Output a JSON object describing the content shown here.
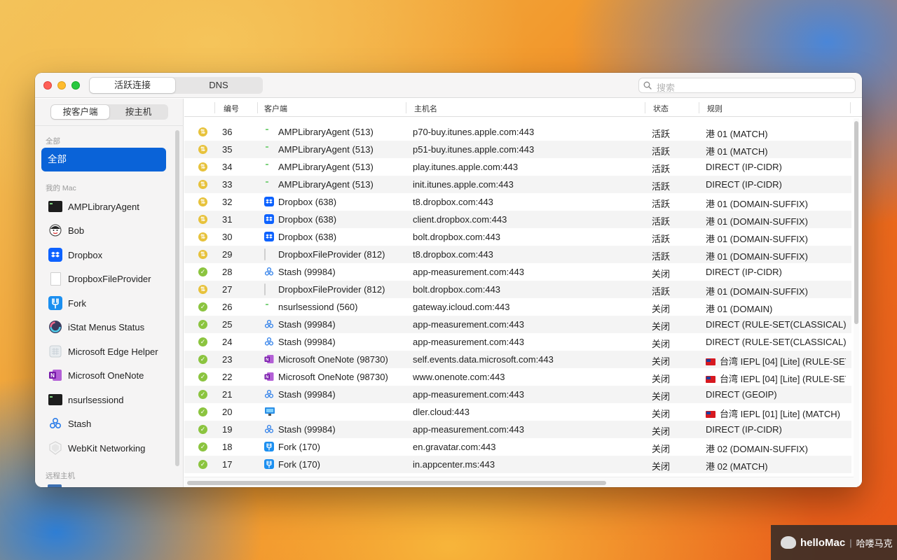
{
  "toolbar": {
    "tabs": [
      {
        "label": "活跃连接",
        "active": true
      },
      {
        "label": "DNS",
        "active": false
      }
    ],
    "search_placeholder": "搜索"
  },
  "sidebar": {
    "segments": [
      {
        "label": "按客户端",
        "active": true
      },
      {
        "label": "按主机",
        "active": false
      }
    ],
    "section_all": "全部",
    "selected": "全部",
    "section_mac": "我的 Mac",
    "items": [
      {
        "label": "AMPLibraryAgent",
        "icon": "terminal-icon"
      },
      {
        "label": "Bob",
        "icon": "bob-icon"
      },
      {
        "label": "Dropbox",
        "icon": "dropbox-icon"
      },
      {
        "label": "DropboxFileProvider",
        "icon": "document-icon"
      },
      {
        "label": "Fork",
        "icon": "fork-icon"
      },
      {
        "label": "iStat Menus Status",
        "icon": "istat-icon"
      },
      {
        "label": "Microsoft Edge Helper",
        "icon": "generic-app-icon"
      },
      {
        "label": "Microsoft OneNote",
        "icon": "onenote-icon"
      },
      {
        "label": "nsurlsessiond",
        "icon": "terminal-icon"
      },
      {
        "label": "Stash",
        "icon": "stash-icon"
      },
      {
        "label": "WebKit Networking",
        "icon": "webkit-icon"
      }
    ],
    "section_remote": "远程主机"
  },
  "table": {
    "headers": {
      "num": "编号",
      "client": "客户端",
      "host": "主机名",
      "state": "状态",
      "rule": "规则"
    },
    "rows": [
      {
        "status": "active",
        "num": "36",
        "client_icon": "terminal-icon",
        "client": "AMPLibraryAgent (513)",
        "host": "p70-buy.itunes.apple.com:443",
        "state": "活跃",
        "rule": "港 01 (MATCH)",
        "flag": false
      },
      {
        "status": "active",
        "num": "35",
        "client_icon": "terminal-icon",
        "client": "AMPLibraryAgent (513)",
        "host": "p51-buy.itunes.apple.com:443",
        "state": "活跃",
        "rule": "港 01 (MATCH)",
        "flag": false
      },
      {
        "status": "active",
        "num": "34",
        "client_icon": "terminal-icon",
        "client": "AMPLibraryAgent (513)",
        "host": "play.itunes.apple.com:443",
        "state": "活跃",
        "rule": "DIRECT (IP-CIDR)",
        "flag": false
      },
      {
        "status": "active",
        "num": "33",
        "client_icon": "terminal-icon",
        "client": "AMPLibraryAgent (513)",
        "host": "init.itunes.apple.com:443",
        "state": "活跃",
        "rule": "DIRECT (IP-CIDR)",
        "flag": false
      },
      {
        "status": "active",
        "num": "32",
        "client_icon": "dropbox-icon",
        "client": "Dropbox (638)",
        "host": "t8.dropbox.com:443",
        "state": "活跃",
        "rule": "港 01 (DOMAIN-SUFFIX)",
        "flag": false
      },
      {
        "status": "active",
        "num": "31",
        "client_icon": "dropbox-icon",
        "client": "Dropbox (638)",
        "host": "client.dropbox.com:443",
        "state": "活跃",
        "rule": "港 01 (DOMAIN-SUFFIX)",
        "flag": false
      },
      {
        "status": "active",
        "num": "30",
        "client_icon": "dropbox-icon",
        "client": "Dropbox (638)",
        "host": "bolt.dropbox.com:443",
        "state": "活跃",
        "rule": "港 01 (DOMAIN-SUFFIX)",
        "flag": false
      },
      {
        "status": "active",
        "num": "29",
        "client_icon": "document-icon",
        "client": "DropboxFileProvider (812)",
        "host": "t8.dropbox.com:443",
        "state": "活跃",
        "rule": "港 01 (DOMAIN-SUFFIX)",
        "flag": false
      },
      {
        "status": "closed",
        "num": "28",
        "client_icon": "stash-icon",
        "client": "Stash (99984)",
        "host": "app-measurement.com:443",
        "state": "关闭",
        "rule": "DIRECT (IP-CIDR)",
        "flag": false
      },
      {
        "status": "active",
        "num": "27",
        "client_icon": "document-icon",
        "client": "DropboxFileProvider (812)",
        "host": "bolt.dropbox.com:443",
        "state": "活跃",
        "rule": "港 01 (DOMAIN-SUFFIX)",
        "flag": false
      },
      {
        "status": "closed",
        "num": "26",
        "client_icon": "terminal-icon",
        "client": "nsurlsessiond (560)",
        "host": "gateway.icloud.com:443",
        "state": "关闭",
        "rule": "港 01 (DOMAIN)",
        "flag": false
      },
      {
        "status": "closed",
        "num": "25",
        "client_icon": "stash-icon",
        "client": "Stash (99984)",
        "host": "app-measurement.com:443",
        "state": "关闭",
        "rule": "DIRECT (RULE-SET(CLASSICAL))",
        "flag": false
      },
      {
        "status": "closed",
        "num": "24",
        "client_icon": "stash-icon",
        "client": "Stash (99984)",
        "host": "app-measurement.com:443",
        "state": "关闭",
        "rule": "DIRECT (RULE-SET(CLASSICAL))",
        "flag": false
      },
      {
        "status": "closed",
        "num": "23",
        "client_icon": "onenote-icon",
        "client": "Microsoft OneNote (98730)",
        "host": "self.events.data.microsoft.com:443",
        "state": "关闭",
        "rule": "台湾 IEPL [04] [Lite] (RULE-SET",
        "flag": true
      },
      {
        "status": "closed",
        "num": "22",
        "client_icon": "onenote-icon",
        "client": "Microsoft OneNote (98730)",
        "host": "www.onenote.com:443",
        "state": "关闭",
        "rule": "台湾 IEPL [04] [Lite] (RULE-SET",
        "flag": true
      },
      {
        "status": "closed",
        "num": "21",
        "client_icon": "stash-icon",
        "client": "Stash (99984)",
        "host": "app-measurement.com:443",
        "state": "关闭",
        "rule": "DIRECT (GEOIP)",
        "flag": false
      },
      {
        "status": "closed",
        "num": "20",
        "client_icon": "monitor-icon",
        "client": "",
        "host": "dler.cloud:443",
        "state": "关闭",
        "rule": "台湾 IEPL [01] [Lite] (MATCH)",
        "flag": true
      },
      {
        "status": "closed",
        "num": "19",
        "client_icon": "stash-icon",
        "client": "Stash (99984)",
        "host": "app-measurement.com:443",
        "state": "关闭",
        "rule": "DIRECT (IP-CIDR)",
        "flag": false
      },
      {
        "status": "closed",
        "num": "18",
        "client_icon": "fork-icon",
        "client": "Fork (170)",
        "host": "en.gravatar.com:443",
        "state": "关闭",
        "rule": "港 02 (DOMAIN-SUFFIX)",
        "flag": false
      },
      {
        "status": "closed",
        "num": "17",
        "client_icon": "fork-icon",
        "client": "Fork (170)",
        "host": "in.appcenter.ms:443",
        "state": "关闭",
        "rule": "港 02 (MATCH)",
        "flag": false
      }
    ]
  },
  "watermark": {
    "brand": "helloMac",
    "cn": "哈喽马克"
  },
  "colors": {
    "accent": "#0a63d8",
    "active_status": "#e7c23b",
    "closed_status": "#8bc43f"
  }
}
